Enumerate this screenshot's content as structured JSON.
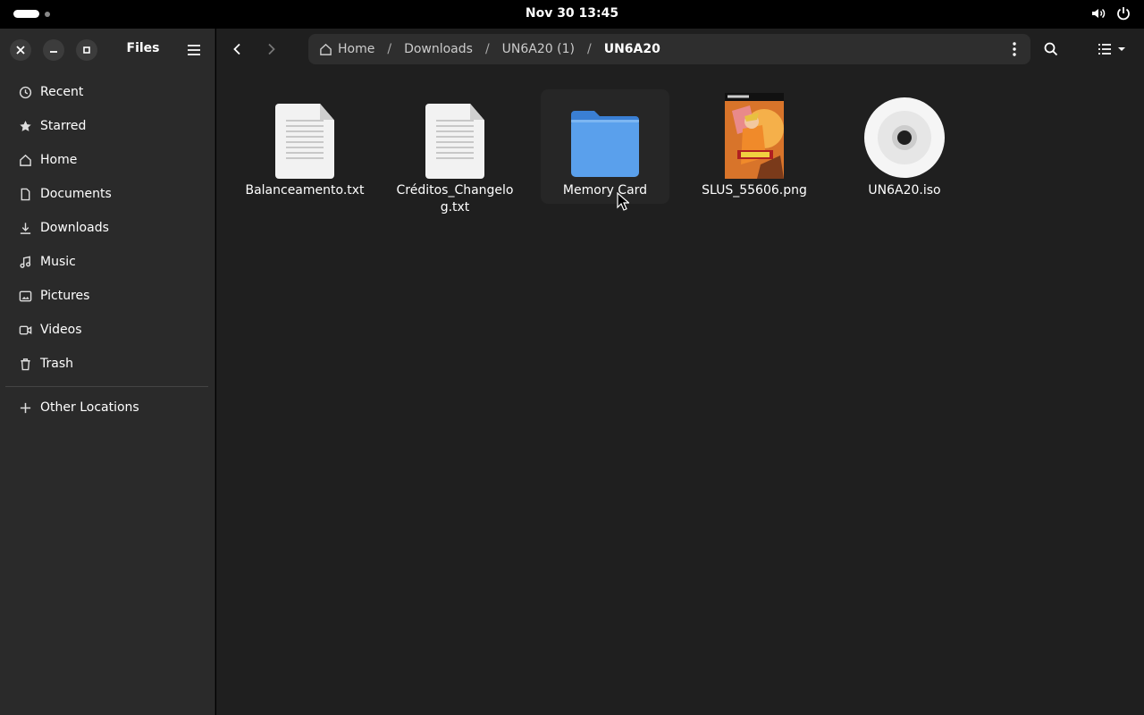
{
  "topbar": {
    "clock": "Nov 30  13:45"
  },
  "window": {
    "title": "Files"
  },
  "sidebar": {
    "items": [
      {
        "label": "Recent",
        "icon": "clock-icon"
      },
      {
        "label": "Starred",
        "icon": "star-icon"
      },
      {
        "label": "Home",
        "icon": "home-icon"
      },
      {
        "label": "Documents",
        "icon": "document-icon"
      },
      {
        "label": "Downloads",
        "icon": "download-icon"
      },
      {
        "label": "Music",
        "icon": "music-icon"
      },
      {
        "label": "Pictures",
        "icon": "picture-icon"
      },
      {
        "label": "Videos",
        "icon": "video-icon"
      },
      {
        "label": "Trash",
        "icon": "trash-icon"
      }
    ],
    "other_locations": "Other Locations"
  },
  "pathbar": {
    "crumbs": [
      "Home",
      "Downloads",
      "UN6A20 (1)",
      "UN6A20"
    ]
  },
  "files": [
    {
      "name": "Balanceamento.txt",
      "type": "text"
    },
    {
      "name": "Créditos_Changelog.txt",
      "type": "text"
    },
    {
      "name": "Memory Card",
      "type": "folder"
    },
    {
      "name": "SLUS_55606.png",
      "type": "image"
    },
    {
      "name": "UN6A20.iso",
      "type": "disc"
    }
  ],
  "colors": {
    "folder": "#4a8fe0",
    "folder_front": "#6aabf0",
    "sidebar_bg": "#2a2a2a",
    "main_bg": "#1f1f1f"
  }
}
